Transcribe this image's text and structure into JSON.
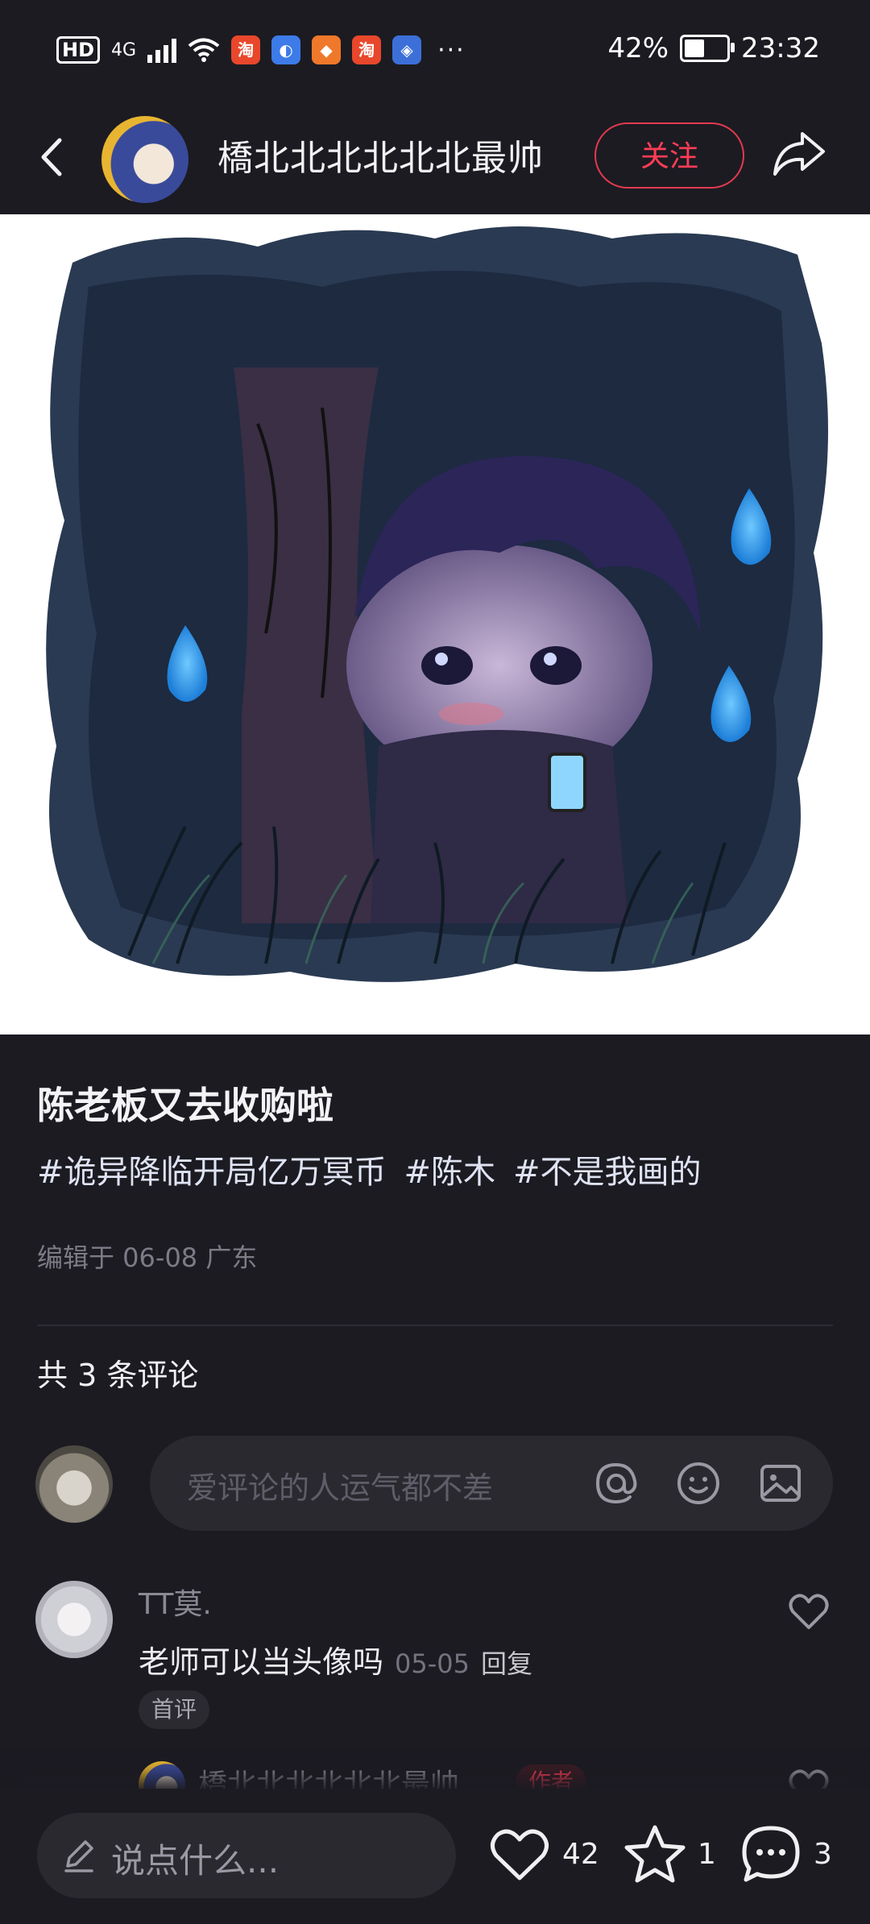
{
  "status_bar": {
    "hd": "HD",
    "network": "4G",
    "battery": "42%",
    "time": "23:32",
    "more": "···"
  },
  "header": {
    "author_name": "橋北北北北北北最帅",
    "follow_label": "关注"
  },
  "post": {
    "title": "陈老板又去收购啦",
    "tags": [
      "#诡异降临开局亿万冥币",
      "#陈木",
      "#不是我画的"
    ],
    "meta": "编辑于 06-08 广东"
  },
  "comments": {
    "count_label": "共 3 条评论",
    "composer_placeholder": "爱评论的人运气都不差",
    "items": [
      {
        "user": "TT莫.",
        "text": "老师可以当头像吗",
        "date": "05-05",
        "reply": "回复",
        "badge": "首评"
      }
    ],
    "reply_preview": {
      "user": "橋北北北北北北最帅",
      "badge": "作者"
    }
  },
  "bottom_bar": {
    "input_placeholder": "说点什么...",
    "likes": "42",
    "favorites": "1",
    "comments": "3"
  },
  "colors": {
    "background": "#1c1b22",
    "accent": "#ff3d56",
    "pill": "#2a2930"
  }
}
